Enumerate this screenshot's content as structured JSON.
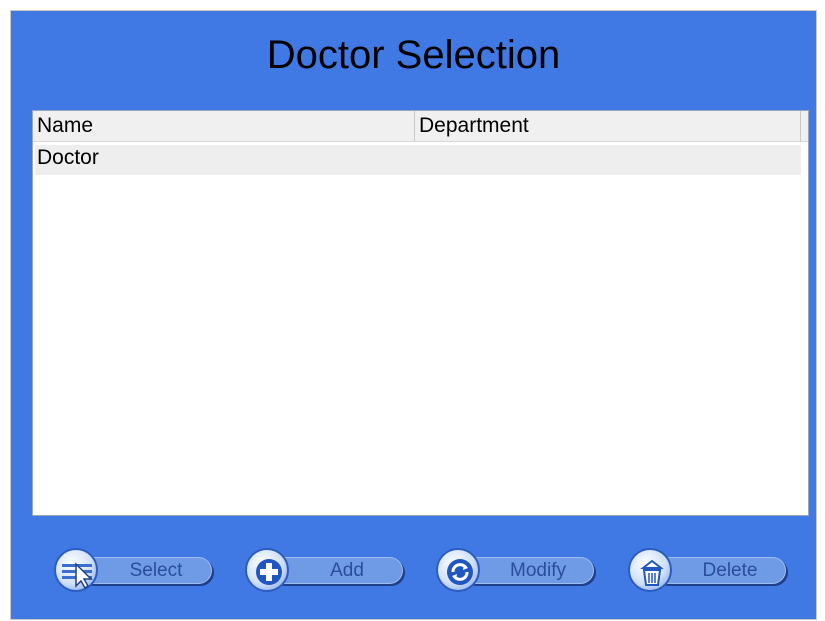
{
  "window": {
    "title": "Doctor Selection"
  },
  "table": {
    "columns": [
      "Name",
      "Department"
    ],
    "rows": [
      {
        "name": "Doctor",
        "department": ""
      }
    ]
  },
  "buttons": {
    "select": {
      "label": "Select",
      "icon": "select-cursor-icon"
    },
    "add": {
      "label": "Add",
      "icon": "plus-icon"
    },
    "modify": {
      "label": "Modify",
      "icon": "refresh-icon"
    },
    "delete": {
      "label": "Delete",
      "icon": "trash-icon"
    }
  },
  "colors": {
    "background": "#4179e4",
    "button": "#6f9be6",
    "button_text": "#2a4d9a"
  }
}
